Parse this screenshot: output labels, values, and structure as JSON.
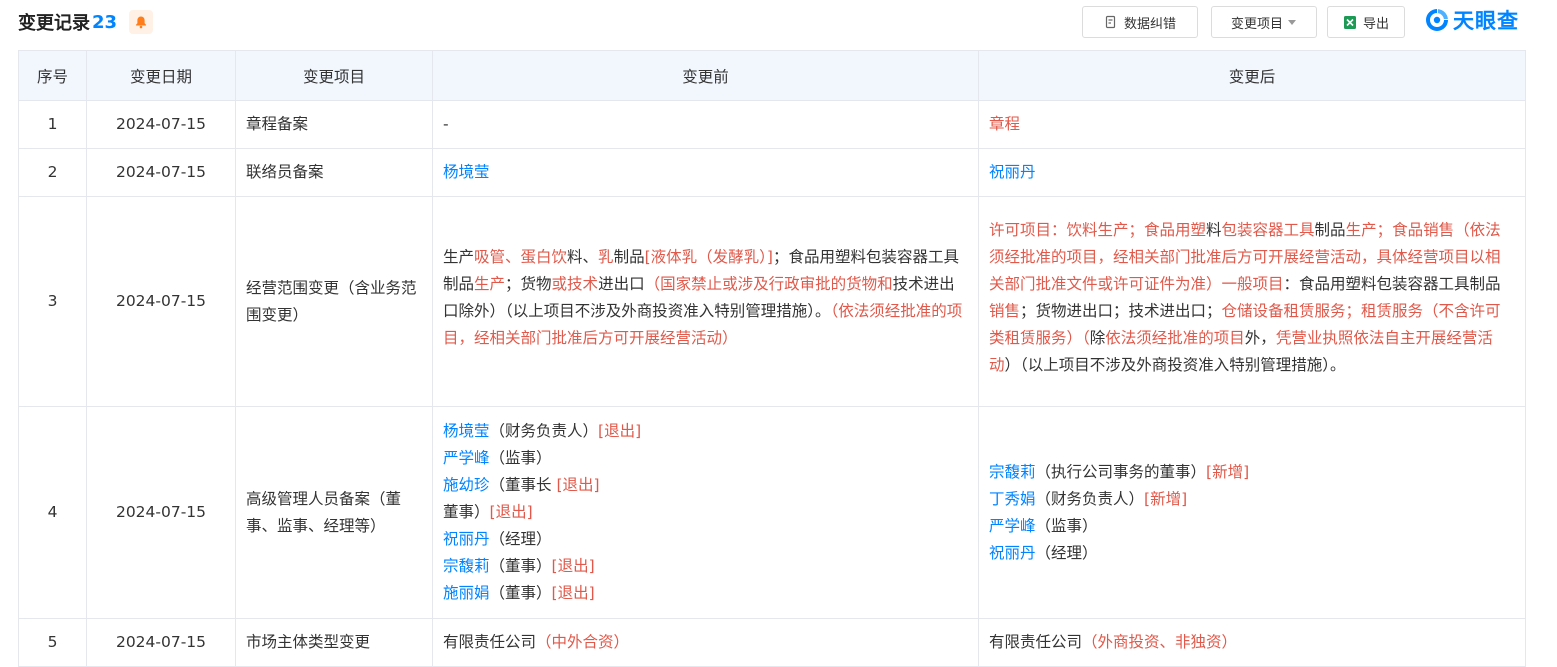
{
  "header": {
    "title": "变更记录",
    "count": "23",
    "buttons": {
      "data_correction": "数据纠错",
      "change_item": "变更项目",
      "export": "导出"
    },
    "logo_text": "天眼查"
  },
  "colors": {
    "brand": "#0084ff",
    "highlight_red": "#e0594a",
    "header_bg": "#f2f7fe"
  },
  "table": {
    "columns": [
      "序号",
      "变更日期",
      "变更项目",
      "变更前",
      "变更后"
    ],
    "rows": [
      {
        "index": "1",
        "date": "2024-07-15",
        "item": "章程备案",
        "before": [
          [
            {
              "t": "-",
              "c": ""
            }
          ]
        ],
        "after": [
          [
            {
              "t": "章程",
              "c": "red"
            }
          ]
        ]
      },
      {
        "index": "2",
        "date": "2024-07-15",
        "item": "联络员备案",
        "before": [
          [
            {
              "t": "杨境莹",
              "c": "blue"
            }
          ]
        ],
        "after": [
          [
            {
              "t": "祝丽丹",
              "c": "blue"
            }
          ]
        ]
      },
      {
        "index": "3",
        "date": "2024-07-15",
        "item": "经营范围变更（含业务范围变更）",
        "before": [
          [
            {
              "t": "生产",
              "c": ""
            },
            {
              "t": "吸管、蛋白饮",
              "c": "red"
            },
            {
              "t": "料、",
              "c": ""
            },
            {
              "t": "乳",
              "c": "red"
            },
            {
              "t": "制品",
              "c": ""
            },
            {
              "t": "[液体乳（发酵乳）]",
              "c": "red"
            },
            {
              "t": "；食品用塑料包装容器工具制品",
              "c": ""
            },
            {
              "t": "生产",
              "c": "red"
            },
            {
              "t": "；货物",
              "c": ""
            },
            {
              "t": "或技术",
              "c": "red"
            },
            {
              "t": "进出口",
              "c": ""
            },
            {
              "t": "（国家禁止或涉及行政审批的货物和",
              "c": "red"
            },
            {
              "t": "技术进出口除外）（以上项目不涉及外商投资准入特别管理措施）。",
              "c": ""
            },
            {
              "t": "（依法须经批准的项目，经相关部门批准后方可开展经营活动）",
              "c": "red"
            }
          ]
        ],
        "after": [
          [
            {
              "t": "许可项目：饮料生产；食品用塑",
              "c": "red"
            },
            {
              "t": "料",
              "c": ""
            },
            {
              "t": "包装容器工具",
              "c": "red"
            },
            {
              "t": "制品",
              "c": ""
            },
            {
              "t": "生产；食品销售",
              "c": "red"
            },
            {
              "t": "（依法须经批准的项目，经相关部门批准后方可开展经营活动，具体经营项目以相关部门批准文件或许可证件为准）一般项目",
              "c": "red"
            },
            {
              "t": "：食品用塑料包装容器工具制品",
              "c": ""
            },
            {
              "t": "销售",
              "c": "red"
            },
            {
              "t": "；货物进出口；技术进出口；",
              "c": ""
            },
            {
              "t": "仓储设备租赁服务；租赁服务（不含许可类租赁服务）（",
              "c": "red"
            },
            {
              "t": "除",
              "c": ""
            },
            {
              "t": "依法须经批准的项目",
              "c": "red"
            },
            {
              "t": "外，",
              "c": ""
            },
            {
              "t": "凭营业执照依法自主开展经营活动",
              "c": "red"
            },
            {
              "t": "）（以上项目不涉及外商投资准入特别管理措施）。",
              "c": ""
            }
          ]
        ]
      },
      {
        "index": "4",
        "date": "2024-07-15",
        "item": "高级管理人员备案（董事、监事、经理等）",
        "before": [
          [
            {
              "t": "杨境莹",
              "c": "blue"
            },
            {
              "t": "（财务负责人）",
              "c": ""
            },
            {
              "t": "[退出]",
              "c": "red"
            }
          ],
          [
            {
              "t": "严学峰",
              "c": "blue"
            },
            {
              "t": "（监事）",
              "c": ""
            }
          ],
          [
            {
              "t": "施幼珍",
              "c": "blue"
            },
            {
              "t": "（董事长 ",
              "c": ""
            },
            {
              "t": "[退出]",
              "c": "red"
            }
          ],
          [
            {
              "t": "董事）",
              "c": ""
            },
            {
              "t": "[退出]",
              "c": "red"
            }
          ],
          [
            {
              "t": "祝丽丹",
              "c": "blue"
            },
            {
              "t": "（经理）",
              "c": ""
            }
          ],
          [
            {
              "t": "宗馥莉",
              "c": "blue"
            },
            {
              "t": "（董事）",
              "c": ""
            },
            {
              "t": "[退出]",
              "c": "red"
            }
          ],
          [
            {
              "t": "施丽娟",
              "c": "blue"
            },
            {
              "t": "（董事）",
              "c": ""
            },
            {
              "t": "[退出]",
              "c": "red"
            }
          ]
        ],
        "after": [
          [
            {
              "t": "宗馥莉",
              "c": "blue"
            },
            {
              "t": "（执行公司事务的董事）",
              "c": ""
            },
            {
              "t": "[新增]",
              "c": "red"
            }
          ],
          [
            {
              "t": "丁秀娟",
              "c": "blue"
            },
            {
              "t": "（财务负责人）",
              "c": ""
            },
            {
              "t": "[新增]",
              "c": "red"
            }
          ],
          [
            {
              "t": "严学峰",
              "c": "blue"
            },
            {
              "t": "（监事）",
              "c": ""
            }
          ],
          [
            {
              "t": "祝丽丹",
              "c": "blue"
            },
            {
              "t": "（经理）",
              "c": ""
            }
          ]
        ]
      },
      {
        "index": "5",
        "date": "2024-07-15",
        "item": "市场主体类型变更",
        "before": [
          [
            {
              "t": "有限责任公司",
              "c": ""
            },
            {
              "t": "（中外合资）",
              "c": "red"
            }
          ]
        ],
        "after": [
          [
            {
              "t": "有限责任公司",
              "c": ""
            },
            {
              "t": "（外商投资、非独资）",
              "c": "red"
            }
          ]
        ]
      }
    ]
  }
}
